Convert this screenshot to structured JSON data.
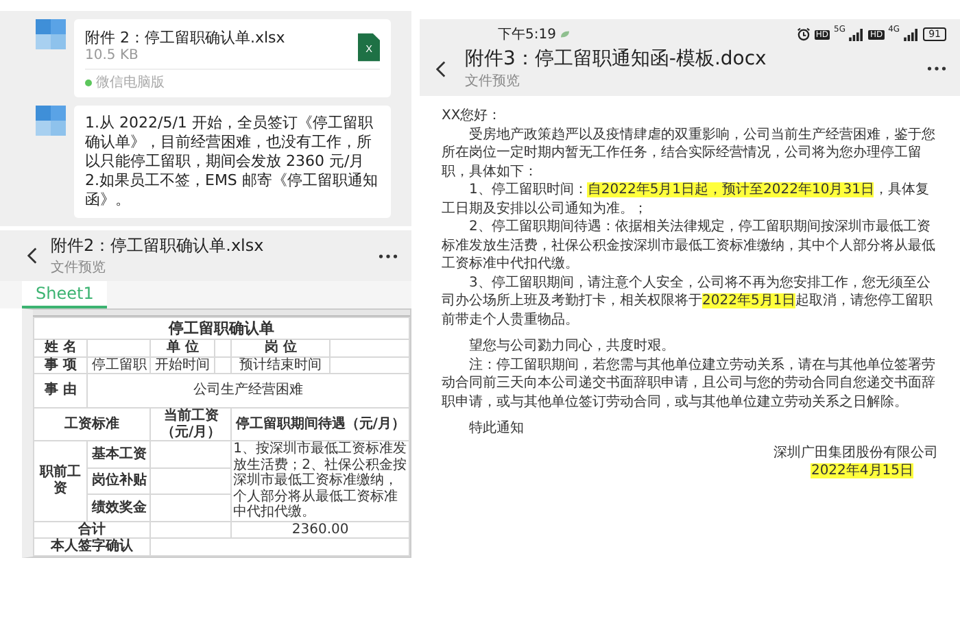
{
  "chat": {
    "messages": [
      {
        "kind": "file",
        "name": "附件 2：停工留职确认单.xlsx",
        "size": "10.5 KB",
        "icon_letter": "X",
        "source": "微信电脑版"
      },
      {
        "kind": "text",
        "lines": [
          "1.从 2022/5/1 开始，全员签订《停工留职确认单》，目前经营困难，也没有工作，所以只能停工留职，期间会发放 2360 元/月",
          "2.如果员工不签，EMS 邮寄《停工留职通知函》。"
        ]
      }
    ]
  },
  "sheet_preview": {
    "title": "附件2：停工留职确认单.xlsx",
    "subtitle": "文件预览",
    "tabs": [
      {
        "label": "Sheet1",
        "selected": true
      }
    ],
    "table_title": "停工留职确认单",
    "cells": [
      "姓 名",
      "单 位",
      "岗 位",
      "事 项",
      "停工留职",
      "开始时间",
      "预计结束时间",
      "事 由",
      "公司生产经营困难",
      "工资标准",
      "当前工资（元/月）",
      "停工留职期间待遇（元/月）",
      "职前工资",
      "基本工资",
      "岗位补贴",
      "绩效奖金",
      "1、按深圳市最低工资标准发放生活费；2、社保公积金按深圳市最低工资标准缴纳，个人部分将从最低工资标准中代扣代缴。",
      "合计",
      "2360.00",
      "本人签字确认"
    ]
  },
  "doc_preview": {
    "status_bar": {
      "time": "下午5:19",
      "networks": [
        {
          "badge": "HD",
          "label": "5G"
        },
        {
          "badge": "HD",
          "label": "4G"
        }
      ],
      "battery": "91"
    },
    "title": "附件3：停工留职通知函-模板.docx",
    "subtitle": "文件预览",
    "paragraphs": [
      {
        "kind": "greeting",
        "parts": [
          {
            "text": "XX您好：",
            "highlight": false
          }
        ]
      },
      {
        "kind": "body",
        "parts": [
          {
            "text": "受房地产政策趋严以及疫情肆虐的双重影响，公司当前生产经营困难，鉴于您所在岗位一定时期内暂无工作任务，结合实际经营情况，公司将为您办理停工留职，具体如下：",
            "highlight": false
          }
        ]
      },
      {
        "kind": "body",
        "parts": [
          {
            "text": "1、停工留职时间：",
            "highlight": false
          },
          {
            "text": "自2022年5月1日起，预计至2022年10月31日",
            "highlight": true
          },
          {
            "text": "，具体复工日期及安排以公司通知为准。；",
            "highlight": false
          }
        ]
      },
      {
        "kind": "body",
        "parts": [
          {
            "text": "2、停工留职期间待遇：依据相关法律规定，停工留职期间按深圳市最低工资标准发放生活费，社保公积金按深圳市最低工资标准缴纳，其中个人部分将从最低工资标准中代扣代缴。",
            "highlight": false
          }
        ]
      },
      {
        "kind": "body",
        "parts": [
          {
            "text": "3、停工留职期间，请注意个人安全，公司将不再为您安排工作，您无须至公司办公场所上班及考勤打卡，相关权限将于",
            "highlight": false
          },
          {
            "text": "2022年5月1日",
            "highlight": true
          },
          {
            "text": "起取消，请您停工留职前带走个人贵重物品。",
            "highlight": false
          }
        ]
      },
      {
        "kind": "spaced",
        "parts": [
          {
            "text": "望您与公司勠力同心，共度时艰。",
            "highlight": false
          }
        ]
      },
      {
        "kind": "body",
        "parts": [
          {
            "text": "注：停工留职期间，若您需与其他单位建立劳动关系，请在与其他单位签署劳动合同前三天向本公司递交书面辞职申请，且公司与您的劳动合同自您递交书面辞职申请，或与其他单位签订劳动合同，或与其他单位建立劳动关系之日解除。",
            "highlight": false
          }
        ]
      },
      {
        "kind": "spaced",
        "parts": [
          {
            "text": "特此通知",
            "highlight": false
          }
        ]
      },
      {
        "kind": "signature",
        "parts": [
          {
            "text": "深圳广田集团股份有限公司",
            "highlight": false
          }
        ]
      },
      {
        "kind": "date",
        "parts": [
          {
            "text": "2022年4月15日",
            "highlight": true
          }
        ]
      }
    ]
  }
}
